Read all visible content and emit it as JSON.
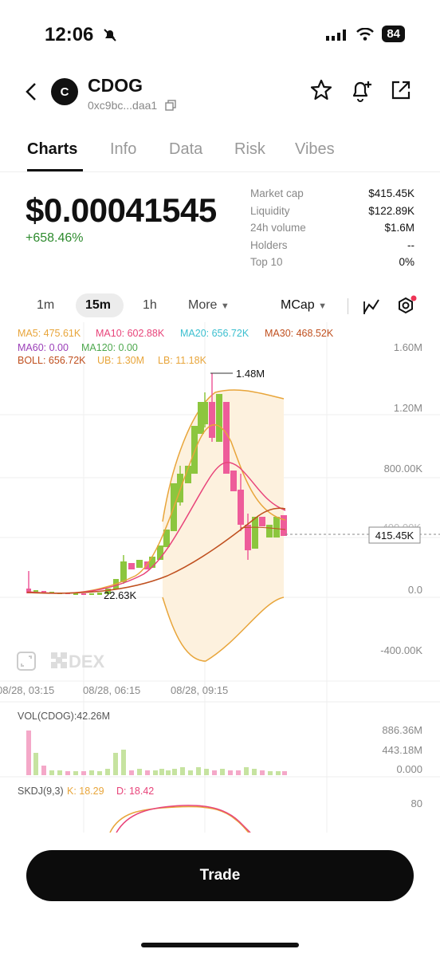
{
  "status": {
    "time": "12:06",
    "battery": "84"
  },
  "header": {
    "token_letter": "C",
    "token_name": "CDOG",
    "address": "0xc9bc...daa1"
  },
  "tabs": [
    "Charts",
    "Info",
    "Data",
    "Risk",
    "Vibes"
  ],
  "summary": {
    "price": "$0.00041545",
    "change": "+658.46%"
  },
  "stats": [
    {
      "label": "Market cap",
      "value": "$415.45K"
    },
    {
      "label": "Liquidity",
      "value": "$122.89K"
    },
    {
      "label": "24h volume",
      "value": "$1.6M"
    },
    {
      "label": "Holders",
      "value": "--"
    },
    {
      "label": "Top 10",
      "value": "0%"
    }
  ],
  "toolbar": {
    "tf_1m": "1m",
    "tf_15m": "15m",
    "tf_1h": "1h",
    "more": "More",
    "mcap": "MCap"
  },
  "indicators": {
    "ma5": "MA5: 475.61K",
    "ma10": "MA10: 602.88K",
    "ma20": "MA20: 656.72K",
    "ma30": "MA30: 468.52K",
    "ma60": "MA60: 0.00",
    "ma120": "MA120: 0.00",
    "boll": "BOLL: 656.72K",
    "ub": "UB: 1.30M",
    "lb": "LB: 11.18K"
  },
  "axis": {
    "y": [
      "1.60M",
      "1.20M",
      "800.00K",
      "0.0",
      "-400.00K"
    ],
    "y_partial": "400.00K",
    "x": [
      "08/28, 03:15",
      "08/28, 06:15",
      "08/28, 09:15"
    ]
  },
  "annotations": {
    "high": "1.48M",
    "low": "22.63K",
    "current": "415.45K"
  },
  "watermark": "DEX",
  "volume": {
    "label": "VOL(CDOG):42.26M",
    "axis": [
      "886.36M",
      "443.18M",
      "0.000"
    ]
  },
  "skdj": {
    "label": "SKDJ(9,3)",
    "k": "K: 18.29",
    "d": "D: 18.42",
    "axis": "80"
  },
  "colors": {
    "up": "#8cc63e",
    "down": "#ee5c9a",
    "ma5": "#e8a53a",
    "ma10": "#e8447a",
    "ma20": "#3bbfcf",
    "ma30": "#c0501f",
    "boll_fill": "#fdf1de"
  },
  "trade_label": "Trade"
}
